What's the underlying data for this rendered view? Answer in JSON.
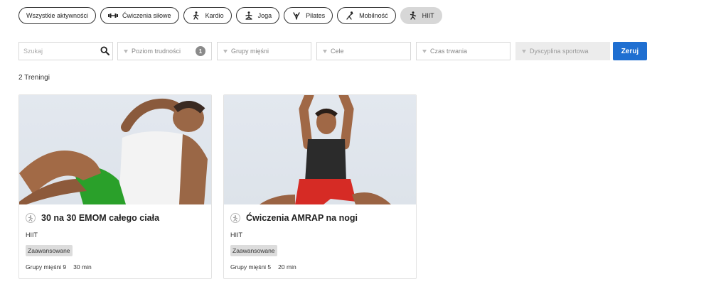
{
  "activities": [
    {
      "label": "Wszystkie aktywności",
      "icon": "",
      "active": false
    },
    {
      "label": "Ćwiczenia siłowe",
      "icon": "dumbbell-icon",
      "active": false
    },
    {
      "label": "Kardio",
      "icon": "running-icon",
      "active": false
    },
    {
      "label": "Joga",
      "icon": "yoga-icon",
      "active": false
    },
    {
      "label": "Pilates",
      "icon": "pilates-icon",
      "active": false
    },
    {
      "label": "Mobilność",
      "icon": "stretch-icon",
      "active": false
    },
    {
      "label": "HIIT",
      "icon": "hiit-icon",
      "active": true
    }
  ],
  "filters": {
    "search_placeholder": "Szukaj",
    "difficulty": "Poziom trudności",
    "difficulty_count": "1",
    "muscle_groups": "Grupy mięśni",
    "goals": "Cele",
    "duration": "Czas trwania",
    "sport": "Dyscyplina sportowa",
    "reset": "Zeruj"
  },
  "results_count": "2 Treningi",
  "workouts": [
    {
      "title": "30 na 30 EMOM całego ciała",
      "category": "HIIT",
      "level": "Zaawansowane",
      "muscle_groups": "Grupy mięśni 9",
      "duration": "30 min"
    },
    {
      "title": "Ćwiczenia AMRAP na nogi",
      "category": "HIIT",
      "level": "Zaawansowane",
      "muscle_groups": "Grupy mięśni 5",
      "duration": "20 min"
    }
  ],
  "colors": {
    "accent": "#1f6fd1",
    "active_chip": "#d7d7d7"
  }
}
